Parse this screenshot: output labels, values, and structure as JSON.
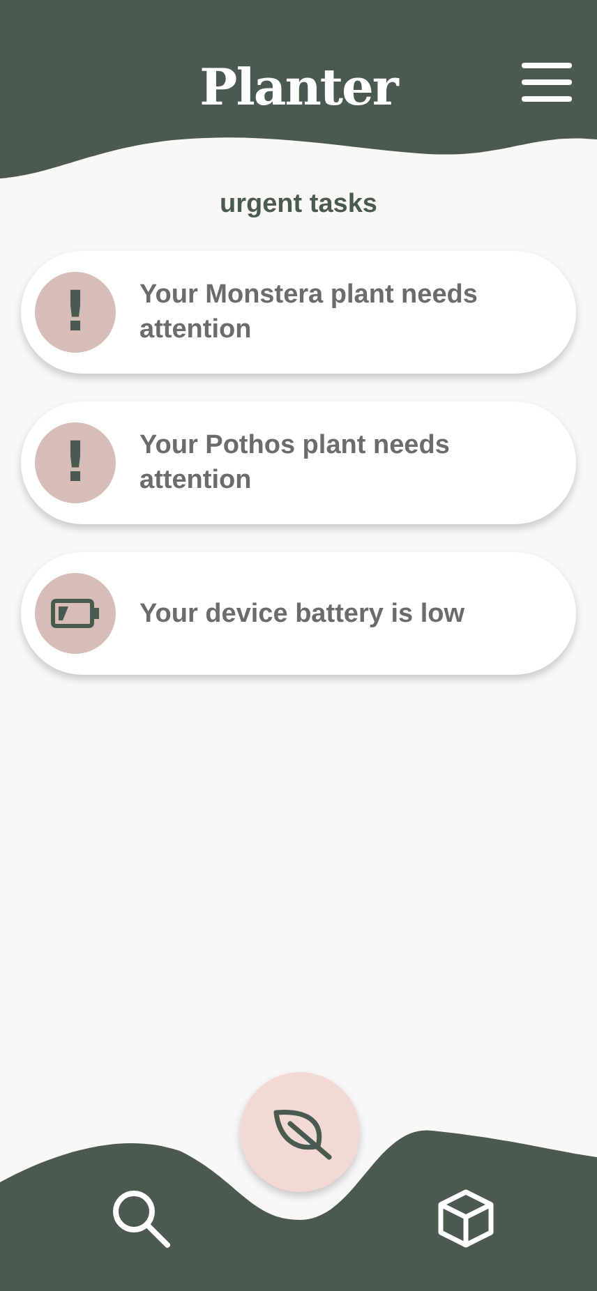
{
  "header": {
    "title": "Planter"
  },
  "section_title": "urgent tasks",
  "tasks": [
    {
      "kind": "alert",
      "icon": "!",
      "text": "Your Monstera plant needs attention"
    },
    {
      "kind": "alert",
      "icon": "!",
      "text": "Your Pothos plant needs attention"
    },
    {
      "kind": "battery",
      "text": "Your device battery is low"
    }
  ]
}
